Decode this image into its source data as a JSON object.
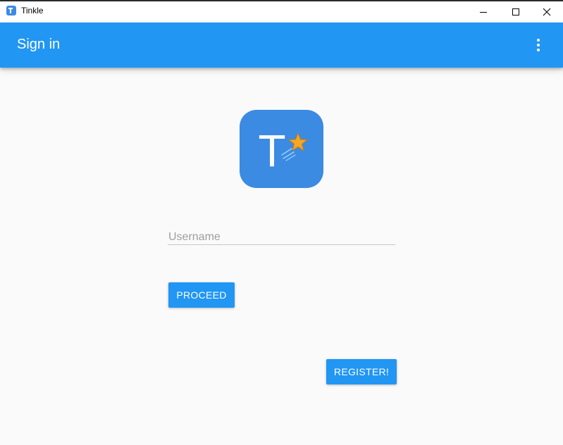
{
  "window": {
    "title": "Tinkle",
    "controls": [
      "minimize-icon",
      "maximize-icon",
      "close-icon"
    ]
  },
  "appbar": {
    "title": "Sign in",
    "menu_icon": "more-vert-icon",
    "color": "#2196f3"
  },
  "logo": {
    "letter": "T",
    "icon": "shooting-star-icon",
    "background": "#3b8be3"
  },
  "form": {
    "username_placeholder": "Username",
    "username_value": "",
    "proceed_label": "PROCEED",
    "register_label": "REGISTER!"
  },
  "colors": {
    "accent": "#2196f3",
    "background": "#fafafa",
    "star": "#f5a623"
  }
}
